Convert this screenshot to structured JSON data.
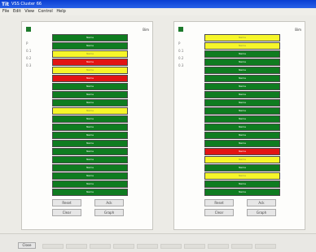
{
  "window": {
    "logo": "Tit",
    "title": "VSS Cluster 66",
    "menus": [
      "File",
      "Edit",
      "View",
      "Control",
      "Help"
    ]
  },
  "left_panel": {
    "unit": "Bim",
    "labels": [
      "P",
      "0.1",
      "0.2",
      "0.3"
    ],
    "rows": [
      {
        "label": "Name",
        "status": "green"
      },
      {
        "label": "Name",
        "status": "green"
      },
      {
        "label": "Name",
        "status": "yellow"
      },
      {
        "label": "Name",
        "status": "red"
      },
      {
        "label": "Name",
        "status": "yellow"
      },
      {
        "label": "Name",
        "status": "red"
      },
      {
        "label": "Name",
        "status": "green"
      },
      {
        "label": "Name",
        "status": "green"
      },
      {
        "label": "Name",
        "status": "green"
      },
      {
        "label": "Name",
        "status": "yellow"
      },
      {
        "label": "Name",
        "status": "green"
      },
      {
        "label": "Name",
        "status": "green"
      },
      {
        "label": "Name",
        "status": "green"
      },
      {
        "label": "Name",
        "status": "green"
      },
      {
        "label": "Name",
        "status": "green"
      },
      {
        "label": "Name",
        "status": "green"
      },
      {
        "label": "Name",
        "status": "green"
      },
      {
        "label": "Name",
        "status": "green"
      },
      {
        "label": "Name",
        "status": "green"
      },
      {
        "label": "Name",
        "status": "green"
      }
    ],
    "buttons": [
      "Reset",
      "Ack",
      "Clear",
      "Graph"
    ]
  },
  "right_panel": {
    "unit": "Bim",
    "labels": [
      "P",
      "0.1",
      "0.2",
      "0.3"
    ],
    "rows": [
      {
        "label": "Name",
        "status": "yellow"
      },
      {
        "label": "Name",
        "status": "yellow"
      },
      {
        "label": "Name",
        "status": "green"
      },
      {
        "label": "Name",
        "status": "green"
      },
      {
        "label": "Name",
        "status": "green"
      },
      {
        "label": "Name",
        "status": "green"
      },
      {
        "label": "Name",
        "status": "green"
      },
      {
        "label": "Name",
        "status": "green"
      },
      {
        "label": "Name",
        "status": "green"
      },
      {
        "label": "Name",
        "status": "green"
      },
      {
        "label": "Name",
        "status": "green"
      },
      {
        "label": "Name",
        "status": "green"
      },
      {
        "label": "Name",
        "status": "green"
      },
      {
        "label": "Name",
        "status": "green"
      },
      {
        "label": "Name",
        "status": "red"
      },
      {
        "label": "Name",
        "status": "yellow"
      },
      {
        "label": "Name",
        "status": "green"
      },
      {
        "label": "Name",
        "status": "yellow"
      },
      {
        "label": "Name",
        "status": "green"
      },
      {
        "label": "Name",
        "status": "green"
      }
    ],
    "buttons": [
      "Reset",
      "Ack",
      "Clear",
      "Graph"
    ]
  },
  "statusbar": {
    "close_label": "Close"
  },
  "colors": {
    "ok": "#0f7c20",
    "warning": "#f6f62a",
    "alarm": "#e21414",
    "titlebar": "#1b50de"
  }
}
